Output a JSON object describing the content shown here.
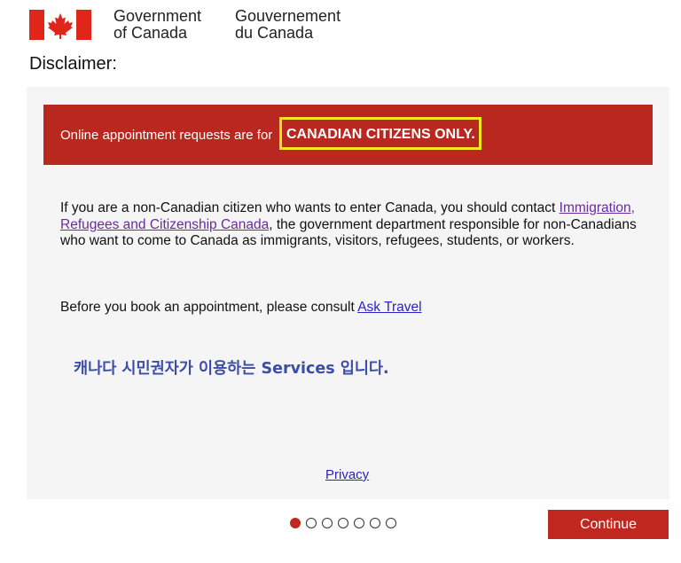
{
  "header": {
    "gov_en_line1": "Government",
    "gov_en_line2": "of Canada",
    "gov_fr_line1": "Gouvernement",
    "gov_fr_line2": "du Canada",
    "flag_icon": "canada-flag-icon"
  },
  "title": "Disclaimer:",
  "alert": {
    "prefix": "Online appointment requests are for ",
    "strong": "CANADIAN CITIZENS ONLY",
    "suffix": "."
  },
  "body": {
    "p1_before": "If you are a non-Canadian citizen who wants to enter Canada, you should contact ",
    "p1_link": "Immigration, Refugees and Citizenship Canada",
    "p1_after": ", the government department responsible for non-Canadians who want to come to Canada as immigrants, visitors, refugees, students, or workers.",
    "p2_before": "Before you book an appointment, please consult ",
    "p2_link": "Ask Travel"
  },
  "overlay_korean": "캐나다 시민권자가 이용하는 Services 입니다.",
  "privacy_link": "Privacy",
  "pagination": {
    "total": 7,
    "current": 1
  },
  "continue_label": "Continue",
  "colors": {
    "brand_red": "#c0281f",
    "alert_red": "#b9281f",
    "highlight": "#f5e81f",
    "link": "#2b22c7",
    "korean_text": "#3c4ca7"
  }
}
